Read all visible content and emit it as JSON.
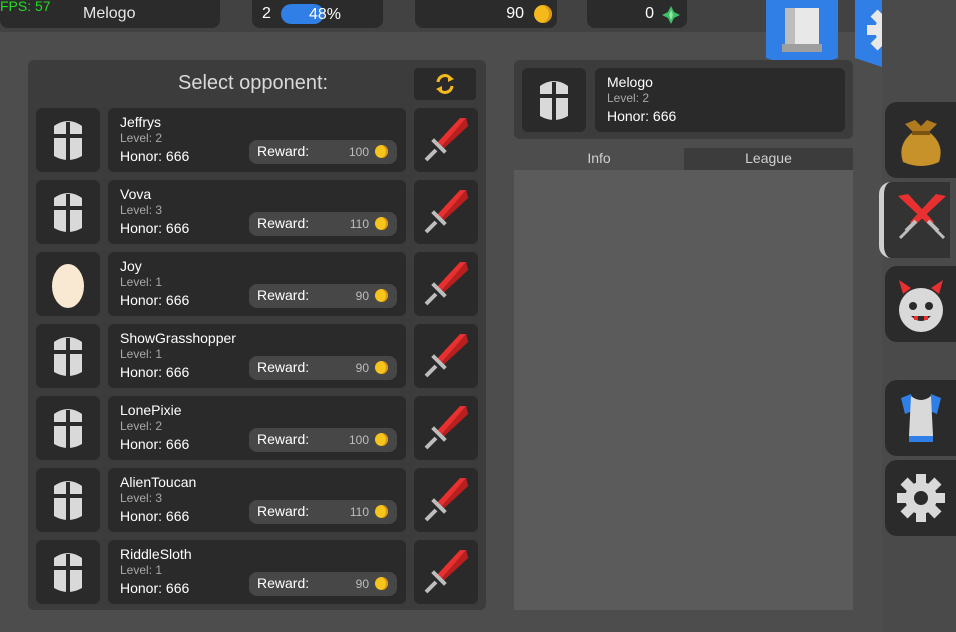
{
  "hud": {
    "fps": "FPS: 57",
    "player_name": "Melogo",
    "level": "2",
    "xp_percent": "48%",
    "xp_fraction": 0.48,
    "gold": "90",
    "gems": "0"
  },
  "opponents_panel": {
    "title": "Select opponent:",
    "reward_label": "Reward:",
    "opponents": [
      {
        "name": "Jeffrys",
        "level": "Level: 2",
        "honor": "Honor: 666",
        "reward": "100",
        "avatar": "knight-helmet-icon"
      },
      {
        "name": "Vova",
        "level": "Level: 3",
        "honor": "Honor: 666",
        "reward": "110",
        "avatar": "knight-helmet-icon"
      },
      {
        "name": "Joy",
        "level": "Level: 1",
        "honor": "Honor: 666",
        "reward": "90",
        "avatar": "egg-icon"
      },
      {
        "name": "ShowGrasshopper",
        "level": "Level: 1",
        "honor": "Honor: 666",
        "reward": "90",
        "avatar": "knight-helmet-icon"
      },
      {
        "name": "LonePixie",
        "level": "Level: 2",
        "honor": "Honor: 666",
        "reward": "100",
        "avatar": "knight-helmet-icon"
      },
      {
        "name": "AlienToucan",
        "level": "Level: 3",
        "honor": "Honor: 666",
        "reward": "110",
        "avatar": "knight-helmet-icon"
      },
      {
        "name": "RiddleSloth",
        "level": "Level: 1",
        "honor": "Honor: 666",
        "reward": "90",
        "avatar": "knight-helmet-icon"
      }
    ]
  },
  "profile": {
    "name": "Melogo",
    "level": "Level: 2",
    "honor": "Honor: 666"
  },
  "tabs": {
    "info": "Info",
    "league": "League",
    "active": "info"
  },
  "sidebar": {
    "items": [
      "loot-bag-icon",
      "crossed-swords-icon",
      "monster-face-icon",
      "armor-icon",
      "gear-icon"
    ],
    "active": "crossed-swords-icon"
  },
  "colors": {
    "accent_blue": "#2f7fe6",
    "gold": "#f5b91c",
    "sword_red": "#e83030",
    "fps_green": "#22dd22"
  }
}
